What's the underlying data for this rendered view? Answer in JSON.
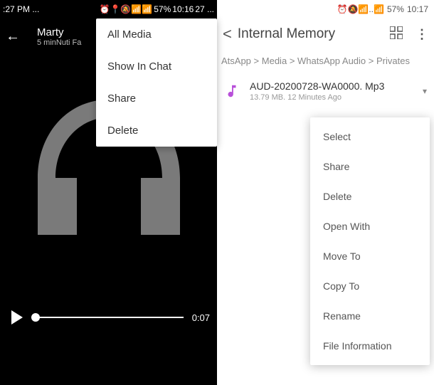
{
  "left": {
    "status": {
      "time_left": ":27 PM ...",
      "battery": "57%",
      "clock": "10:16",
      "extra": "27 ..."
    },
    "header": {
      "title": "Marty",
      "subtitle": "5 minNuti Fa"
    },
    "menu": [
      "All Media",
      "Show In Chat",
      "Share",
      "Delete"
    ],
    "player": {
      "time": "0:07"
    }
  },
  "right": {
    "status": {
      "battery": "57%",
      "clock": "10:17"
    },
    "header": {
      "title": "Internal Memory"
    },
    "breadcrumb": {
      "p1": "AtsApp",
      "p2": "Media",
      "p3": "WhatsApp Audio",
      "p4": "Privates"
    },
    "file": {
      "name": "AUD-20200728-WA0000. Mp3",
      "meta": "13.79 MB. 12 Minutes Ago"
    },
    "menu": [
      "Select",
      "Share",
      "Delete",
      "Open With",
      "Move To",
      "Copy To",
      "Rename",
      "File Information"
    ]
  }
}
